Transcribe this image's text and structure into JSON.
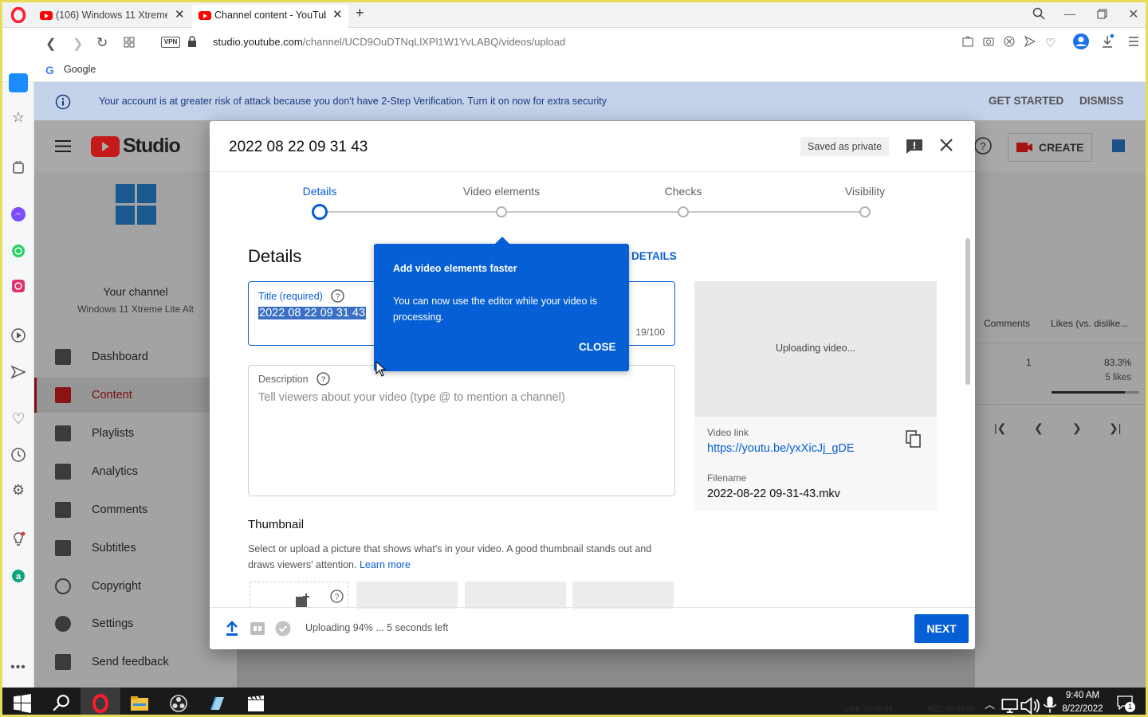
{
  "browser": {
    "tabs": [
      {
        "title": "(106) Windows 11 Xtreme"
      },
      {
        "title": "Channel content - YouTube"
      }
    ],
    "url_host": "studio.youtube.com",
    "url_path": "/channel/UCD9OuDTNqLlXPl1W1YvLABQ/videos/upload",
    "vpn_label": "VPN",
    "bookmark": "Google"
  },
  "banner": {
    "text": "Your account is at greater risk of attack because you don't have 2-Step Verification. Turn it on now for extra security",
    "get_started": "GET STARTED",
    "dismiss": "DISMISS"
  },
  "studio": {
    "logo": "Studio",
    "create": "CREATE",
    "channel_title": "Your channel",
    "channel_name": "Windows 11 Xtreme Lite Alt",
    "nav": [
      {
        "label": "Dashboard",
        "icon": "dashboard-icon"
      },
      {
        "label": "Content",
        "icon": "content-icon"
      },
      {
        "label": "Playlists",
        "icon": "playlists-icon"
      },
      {
        "label": "Analytics",
        "icon": "analytics-icon"
      },
      {
        "label": "Comments",
        "icon": "comments-icon"
      },
      {
        "label": "Subtitles",
        "icon": "subtitles-icon"
      },
      {
        "label": "Copyright",
        "icon": "copyright-icon"
      },
      {
        "label": "Settings",
        "icon": "settings-icon"
      },
      {
        "label": "Send feedback",
        "icon": "feedback-icon"
      }
    ],
    "table": {
      "col_comments": "Comments",
      "col_likes": "Likes (vs. dislike...",
      "comments_val": "1",
      "likes_pct": "83.3%",
      "likes_count": "5 likes",
      "likes_ratio": 0.833
    }
  },
  "modal": {
    "title": "2022 08 22 09 31 43",
    "saved": "Saved as private",
    "steps": [
      "Details",
      "Video elements",
      "Checks",
      "Visibility"
    ],
    "heading": "Details",
    "reuse_link": "DETAILS",
    "title_label": "Title (required)",
    "title_value": "2022 08 22 09 31 43",
    "title_count": "19/100",
    "desc_label": "Description",
    "desc_placeholder": "Tell viewers about your video (type @ to mention a channel)",
    "thumb_heading": "Thumbnail",
    "thumb_text": "Select or upload a picture that shows what's in your video. A good thumbnail stands out and draws viewers' attention.",
    "learn_more": "Learn more",
    "preview_status": "Uploading video...",
    "video_link_label": "Video link",
    "video_link": "https://youtu.be/yxXicJj_gDE",
    "filename_label": "Filename",
    "filename": "2022-08-22 09-31-43.mkv",
    "upload_status": "Uploading 94% ... 5 seconds left",
    "upload_progress": 0.94,
    "next": "NEXT"
  },
  "popup": {
    "heading": "Add video elements faster",
    "body": "You can now use the editor while your video is processing.",
    "close": "CLOSE"
  },
  "taskbar": {
    "time": "9:40 AM",
    "date": "8/22/2022",
    "live": "LIVE: 00:00:00",
    "rec": "REC: 00:00:00",
    "notif_count": "1"
  },
  "colors": {
    "accent": "#065fd4",
    "youtube_red": "#ff0000",
    "opera_red": "#ff1b2d"
  }
}
